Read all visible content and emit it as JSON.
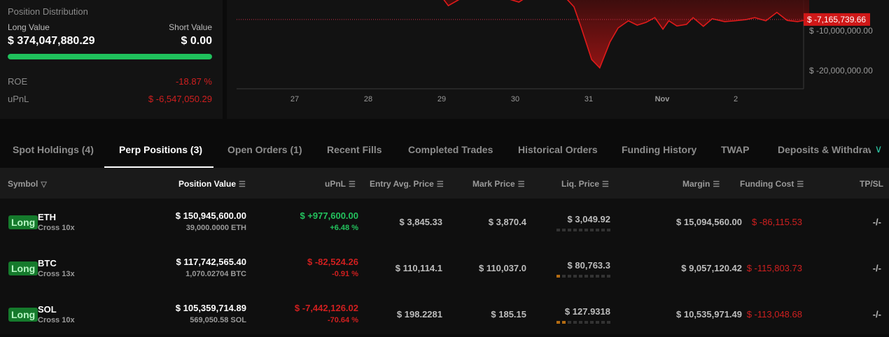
{
  "position_distribution": {
    "title": "Position Distribution",
    "long_label": "Long Value",
    "short_label": "Short Value",
    "long_value": "$ 374,047,880.29",
    "short_value": "$ 0.00",
    "long_fraction": 1.0,
    "roe_label": "ROE",
    "roe_value": "-18.87 %",
    "upnl_label": "uPnL",
    "upnl_value": "$ -6,547,050.29"
  },
  "chart_data": {
    "type": "area",
    "x_tick_labels": [
      "27",
      "28",
      "29",
      "30",
      "31",
      "Nov",
      "2"
    ],
    "x_tick_days": [
      27,
      28,
      29,
      30,
      31,
      32,
      33
    ],
    "y_tick_labels": [
      "$ -10,000,000.00",
      "$ -20,000,000.00"
    ],
    "y_ticks": [
      -10,
      -20
    ],
    "y_unit": "millions USD",
    "current_value_label": "$ -7,165,739.66",
    "current_value": -7.17,
    "series": [
      {
        "name": "PnL",
        "day": [
          29.0,
          29.09,
          29.3,
          29.7,
          30.05,
          30.25,
          30.67,
          30.8,
          30.9,
          31.04,
          31.15,
          31.29,
          31.4,
          31.54,
          31.66,
          31.78,
          31.9,
          32.01,
          32.09,
          32.2,
          32.33,
          32.42,
          32.56,
          32.68,
          32.85,
          32.99,
          33.14,
          33.26,
          33.41,
          33.56,
          33.7,
          33.84,
          34.0
        ],
        "value": [
          -1.5,
          -3.7,
          -1.5,
          -0.9,
          -2.8,
          -0.5,
          -1.4,
          -4.0,
          -9.3,
          -17.2,
          -19.3,
          -12.8,
          -9.3,
          -7.5,
          -8.6,
          -7.9,
          -6.7,
          -9.6,
          -7.5,
          -8.8,
          -8.4,
          -6.7,
          -8.9,
          -7.0,
          -7.7,
          -7.5,
          -7.2,
          -6.7,
          -7.5,
          -5.4,
          -7.4,
          -7.7,
          -7.17
        ]
      }
    ]
  },
  "tabs": [
    "Spot Holdings (4)",
    "Perp Positions (3)",
    "Open Orders (1)",
    "Recent Fills",
    "Completed Trades",
    "Historical Orders",
    "Funding History",
    "TWAP",
    "Deposits & Withdraw"
  ],
  "columns": {
    "symbol": "Symbol",
    "position_value": "Position Value",
    "upnl": "uPnL",
    "entry": "Entry Avg. Price",
    "mark": "Mark Price",
    "liq": "Liq. Price",
    "margin": "Margin",
    "funding": "Funding Cost",
    "tpsl": "TP/SL"
  },
  "positions": [
    {
      "side": "Long",
      "symbol": "ETH",
      "mode": "Cross 10x",
      "value": "$ 150,945,600.00",
      "size": "39,000.0000 ETH",
      "upnl": "$ +977,600.00",
      "upnl_pct": "+6.48 %",
      "entry": "$ 3,845.33",
      "mark": "$ 3,870.4",
      "liq": "$ 3,049.92",
      "liq_risk": 0,
      "margin": "$ 15,094,560.00",
      "funding": "$ -86,115.53",
      "tpsl": "-/-"
    },
    {
      "side": "Long",
      "symbol": "BTC",
      "mode": "Cross 13x",
      "value": "$ 117,742,565.40",
      "size": "1,070.02704 BTC",
      "upnl": "$ -82,524.26",
      "upnl_pct": "-0.91 %",
      "entry": "$ 110,114.1",
      "mark": "$ 110,037.0",
      "liq": "$ 80,763.3",
      "liq_risk": 1,
      "margin": "$ 9,057,120.42",
      "funding": "$ -115,803.73",
      "tpsl": "-/-"
    },
    {
      "side": "Long",
      "symbol": "SOL",
      "mode": "Cross 10x",
      "value": "$ 105,359,714.89",
      "size": "569,050.58 SOL",
      "upnl": "$ -7,442,126.02",
      "upnl_pct": "-70.64 %",
      "entry": "$ 198.2281",
      "mark": "$ 185.15",
      "liq": "$ 127.9318",
      "liq_risk": 2,
      "margin": "$ 10,535,971.49",
      "funding": "$ -113,048.68",
      "tpsl": "-/-"
    }
  ],
  "colors": {
    "green": "#1fc15c",
    "red": "#d01f1f",
    "accent": "#2bbd9d"
  }
}
